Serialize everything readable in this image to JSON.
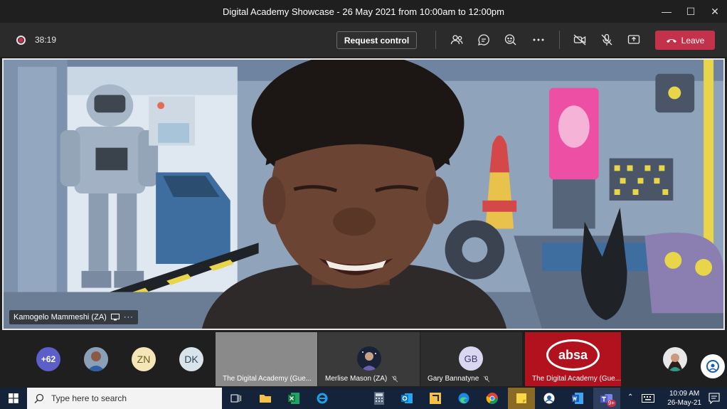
{
  "window": {
    "title": "Digital Academy Showcase - 26 May 2021 from 10:00am to 12:00pm"
  },
  "toolbar": {
    "timer": "38:19",
    "request_control_label": "Request control",
    "leave_label": "Leave",
    "icons": [
      "participants-icon",
      "chat-icon",
      "reactions-icon",
      "more-options-icon",
      "camera-off-icon",
      "mic-off-icon",
      "share-screen-icon"
    ]
  },
  "stage": {
    "speaker_name": "Kamogelo Mammeshi (ZA)"
  },
  "participants": {
    "overflow_count": "+62",
    "avatars": [
      {
        "initials": "ZN",
        "color": "#f5e6b8",
        "text_color": "#6b5a1e"
      },
      {
        "initials": "DK",
        "color": "#d9e4ea",
        "text_color": "#2f4a5a"
      }
    ],
    "tiles": [
      {
        "name": "The Digital Academy (Gue..."
      },
      {
        "name": "Merlise Mason (ZA)"
      },
      {
        "name": "Gary Bannatyne",
        "initials": "GB"
      },
      {
        "name": "The Digital Academy (Gue...",
        "logo": "absa"
      }
    ]
  },
  "taskbar": {
    "search_placeholder": "Type here to search",
    "time": "10:09 AM",
    "date": "26-May-21",
    "teams_badge": "9+"
  }
}
